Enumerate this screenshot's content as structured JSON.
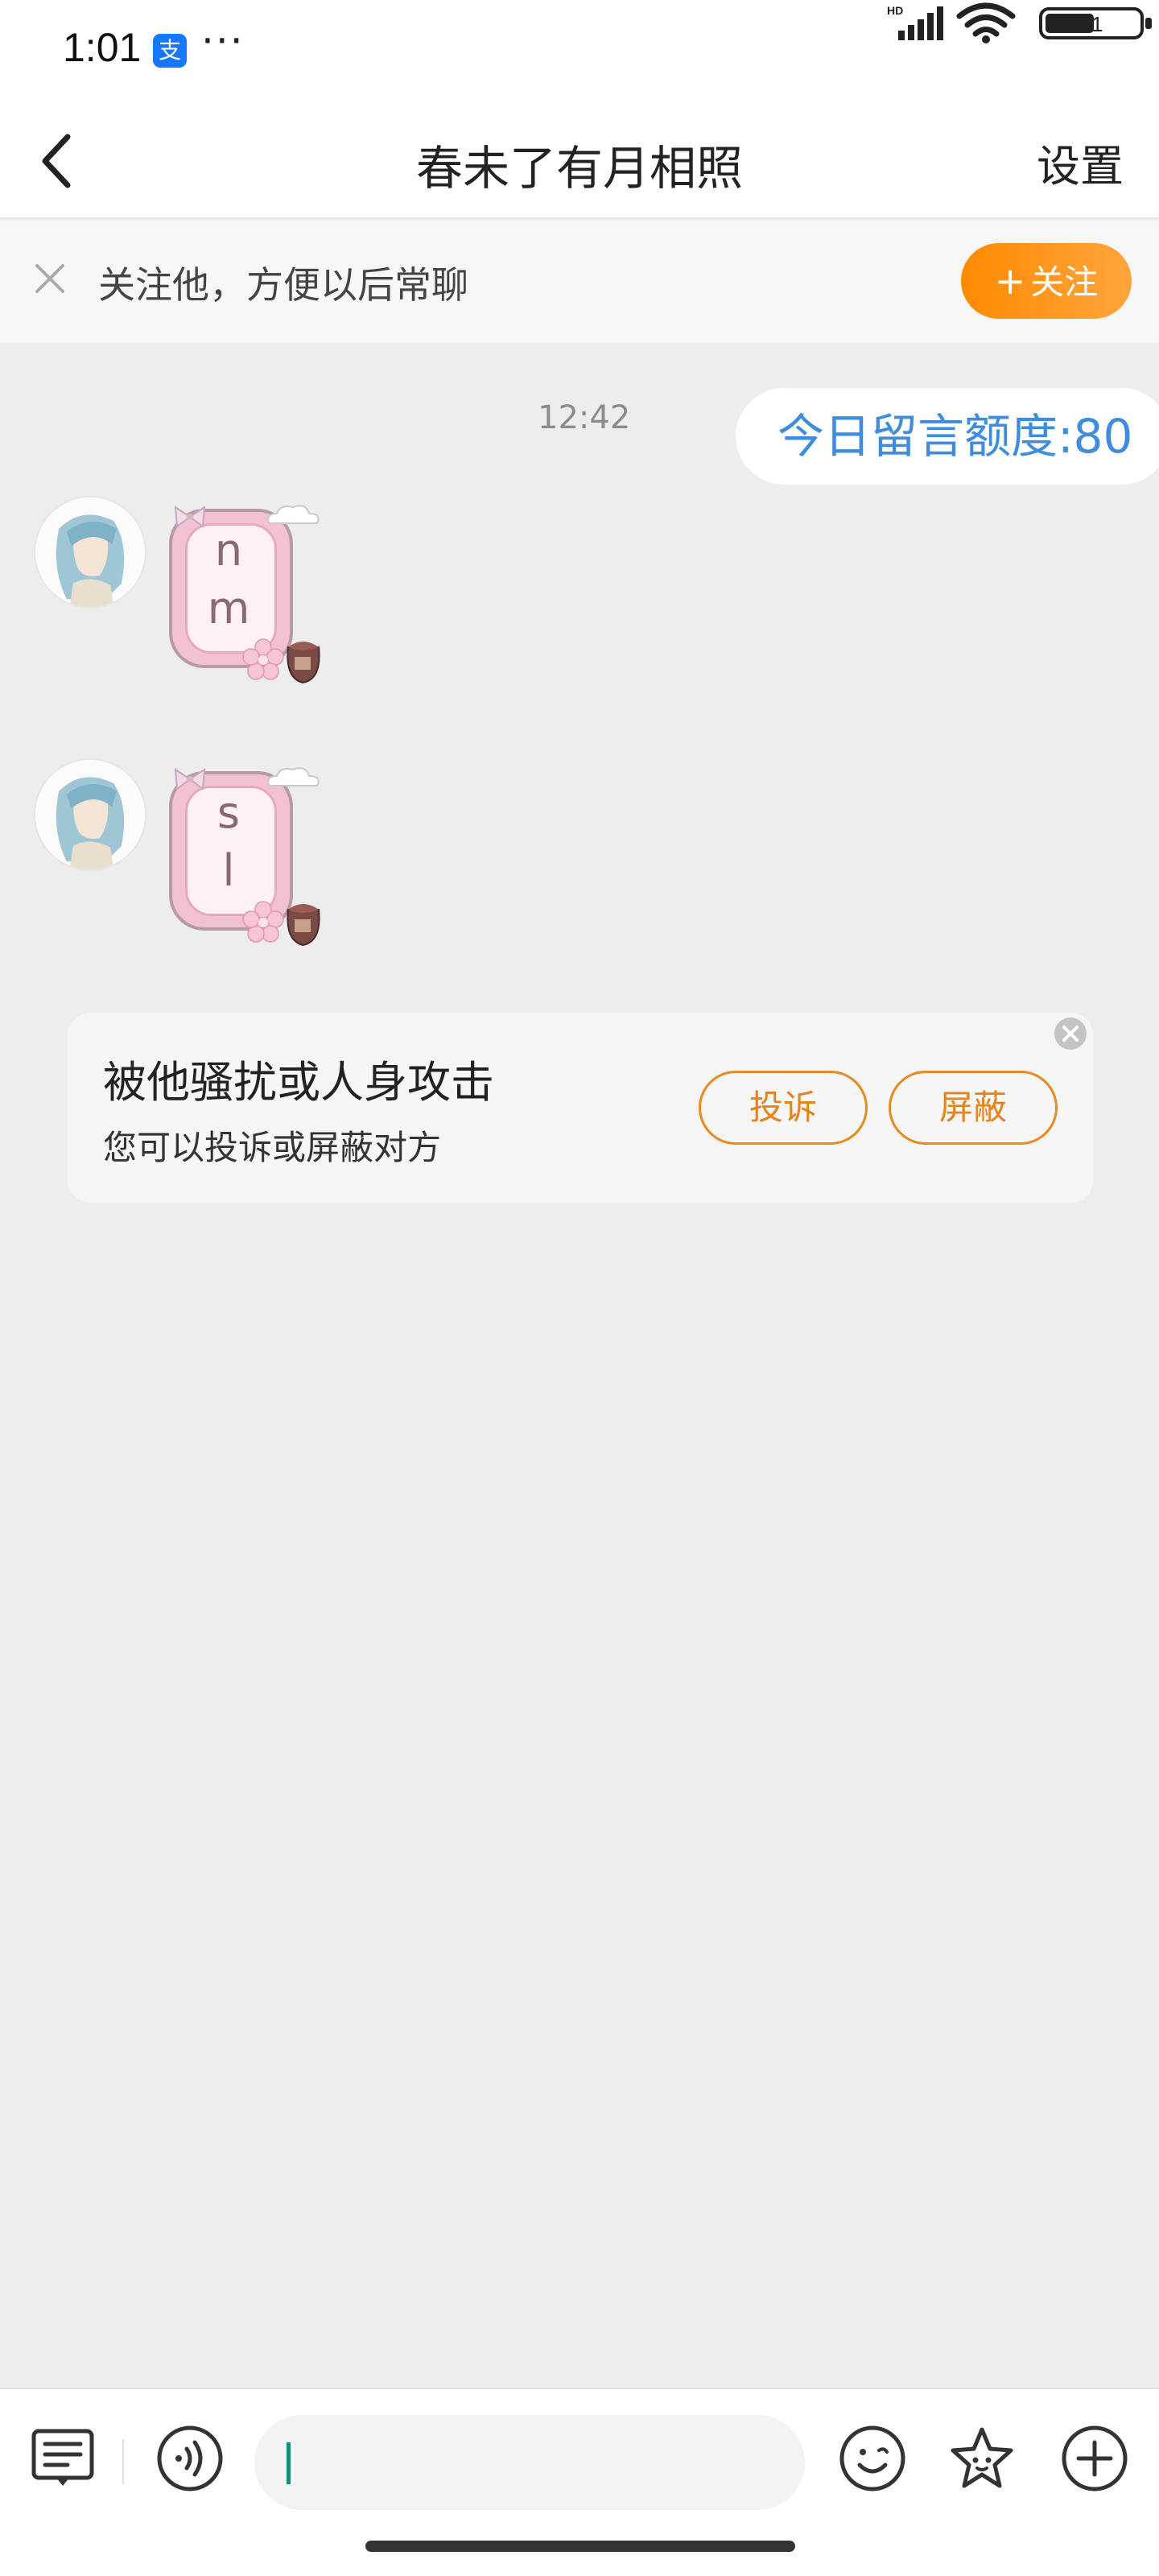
{
  "status_bar": {
    "time": "1:01",
    "app_icon_glyph": "支",
    "more": "···",
    "network_label": "HD",
    "battery": "51"
  },
  "nav": {
    "title": "春未了有月相照",
    "settings": "设置"
  },
  "follow_banner": {
    "text": "关注他，方便以后常聊",
    "button_label": "关注",
    "button_color": "#ff8a00"
  },
  "chat": {
    "timestamp": "12:42",
    "quota": "今日留言额度:80",
    "quota_color": "#3c8de0",
    "messages": [
      {
        "sender": "other",
        "text_lines": [
          "n",
          "m"
        ]
      },
      {
        "sender": "other",
        "text_lines": [
          "s",
          "l"
        ]
      }
    ]
  },
  "report_card": {
    "title": "被他骚扰或人身攻击",
    "subtitle": "您可以投诉或屏蔽对方",
    "complain_label": "投诉",
    "block_label": "屏蔽",
    "accent": "#e8821a"
  },
  "input_bar": {
    "value": "",
    "icons": [
      "menu-toggle-icon",
      "voice-icon",
      "emoji-icon",
      "sticker-icon",
      "plus-icon"
    ]
  }
}
